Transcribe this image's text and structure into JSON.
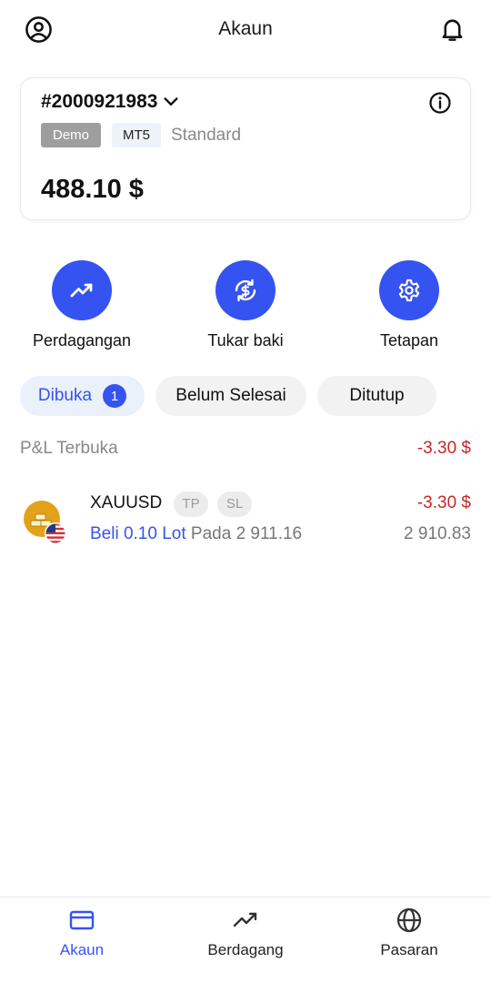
{
  "header": {
    "title": "Akaun"
  },
  "account": {
    "number": "#2000921983",
    "badge_demo": "Demo",
    "badge_platform": "MT5",
    "type": "Standard",
    "balance": "488.10 $"
  },
  "actions": [
    {
      "label": "Perdagangan",
      "icon": "trend-up-icon"
    },
    {
      "label": "Tukar baki",
      "icon": "exchange-dollar-icon"
    },
    {
      "label": "Tetapan",
      "icon": "gear-icon"
    }
  ],
  "tabs": [
    {
      "label": "Dibuka",
      "count": "1",
      "active": true
    },
    {
      "label": "Belum Selesai"
    },
    {
      "label": "Ditutup"
    }
  ],
  "pnl": {
    "label": "P&L Terbuka",
    "value": "-3.30 $"
  },
  "positions": [
    {
      "symbol": "XAUUSD",
      "tp": "TP",
      "sl": "SL",
      "pnl": "-3.30 $",
      "direction": "Beli 0.10 Lot",
      "at": "Pada 2 911.16",
      "current_price": "2 910.83"
    }
  ],
  "nav": [
    {
      "label": "Akaun",
      "icon": "card-icon",
      "active": true
    },
    {
      "label": "Berdagang",
      "icon": "trend-up-icon"
    },
    {
      "label": "Pasaran",
      "icon": "globe-icon"
    }
  ],
  "colors": {
    "accent": "#3553f0",
    "negative": "#c62828",
    "muted": "#888888"
  }
}
